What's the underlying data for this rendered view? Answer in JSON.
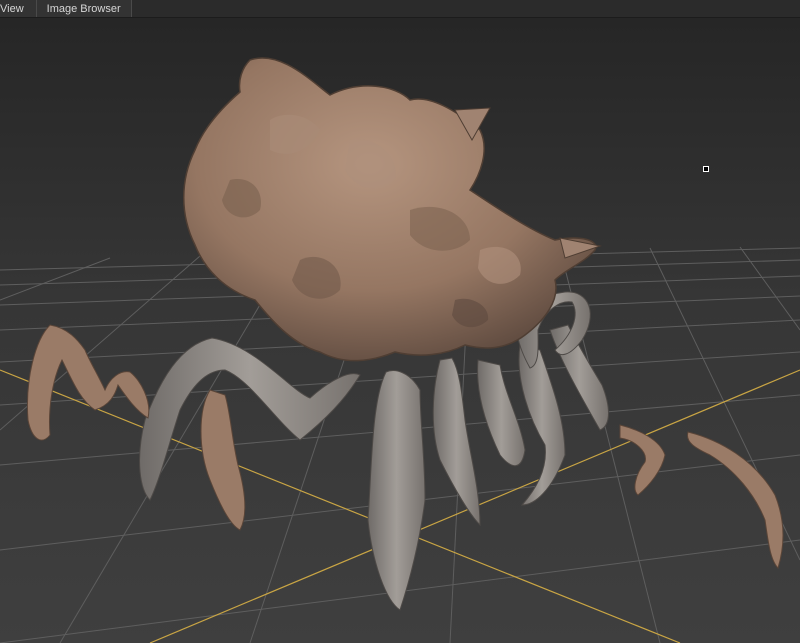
{
  "tabs": {
    "view": "View",
    "image_browser": "Image Browser"
  },
  "colors": {
    "background": "#3a3a3a",
    "grid": "#5a5a5a",
    "axis": "#c9a544",
    "creature": "#9a7b67",
    "legs": "#8c8782"
  },
  "icons": {
    "cursor": "cursor-crosshair-icon"
  }
}
